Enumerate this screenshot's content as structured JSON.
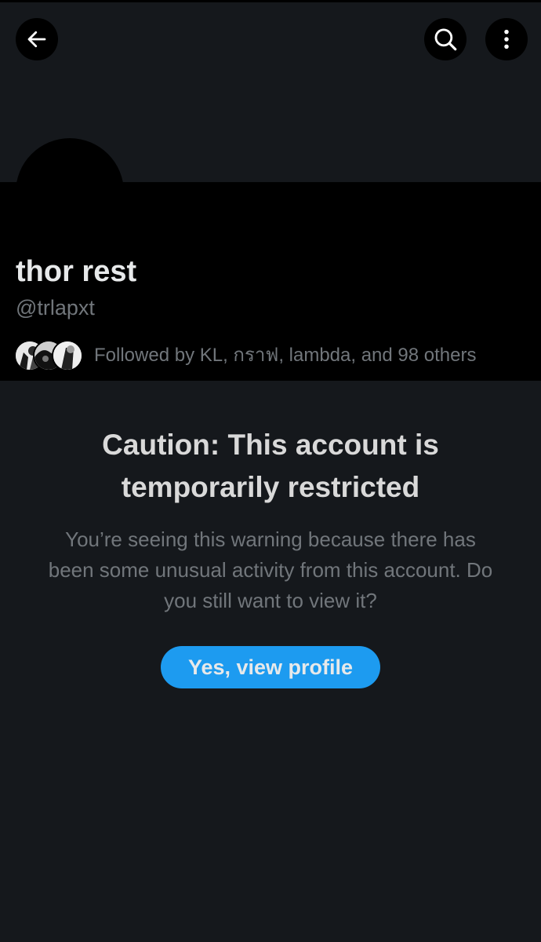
{
  "profile": {
    "display_name": "thor rest",
    "handle": "@trlapxt",
    "followed_by": "Followed by KL, กราฟ, lambda, and 98 others"
  },
  "caution": {
    "title": "Caution: This account is temporarily restricted",
    "body": "You’re seeing this warning because there has been some unusual activity from this account. Do you still want to view it?",
    "button_label": "Yes, view profile"
  },
  "icons": {
    "back": "arrow-left-icon",
    "search": "search-icon",
    "more": "more-vertical-icon"
  },
  "colors": {
    "background": "#15181c",
    "accent": "#1d9bf0",
    "secondary_text": "#71767b"
  }
}
